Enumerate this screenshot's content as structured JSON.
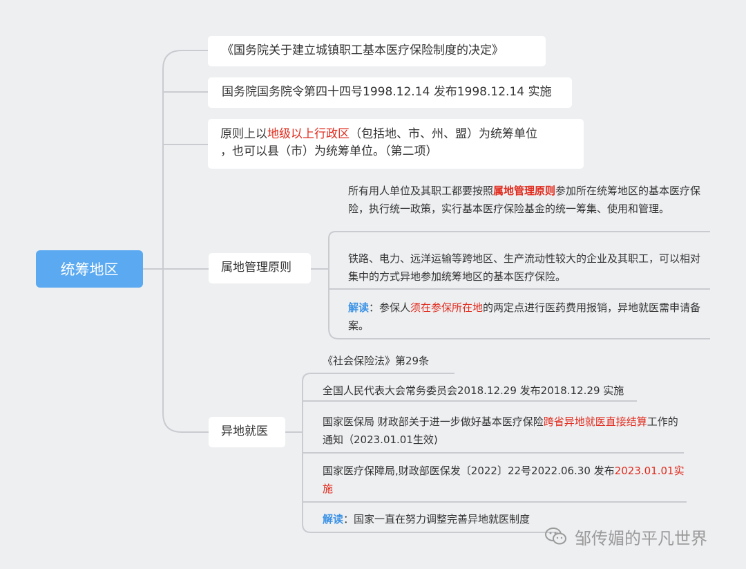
{
  "root": {
    "label": "统筹地区"
  },
  "branches": {
    "doc_title": "《国务院关于建立城镇职工基本医疗保险制度的决定》",
    "decree": "国务院国务院令第四十四号1998.12.14 发布1998.12.14 实施",
    "principle": {
      "pre": "原则上以",
      "hl": "地级以上行政区",
      "post": "（包括地、市、州、盟）为统筹单位",
      "line2": "，也可以县（市）为统筹单位。（第二项）"
    },
    "local_mgmt": {
      "label": "属地管理原则",
      "item1": {
        "pre": "所有用人单位及其职工都要按照",
        "hl": "属地管理原则",
        "post": "参加所在统筹地区的基本医疗保险，执行统一政策，实行基本医疗保险基金的统一筹集、使用和管理。"
      },
      "item2": "铁路、电力、远洋运输等跨地区、生产流动性较大的企业及其职工，可以相对集中的方式异地参加统筹地区的基本医疗保险。",
      "item3": {
        "tag": "解读",
        "pre": "：参保人",
        "hl": "须在参保所在地",
        "post": "的两定点进行医药费用报销，异地就医需申请备案。"
      }
    },
    "remote": {
      "label": "异地就医",
      "law": "《社会保险法》第29条",
      "law_pub": "全国人民代表大会常务委员会2018.12.29 发布2018.12.29 实施",
      "notice": {
        "pre": "国家医保局 财政部关于进一步做好基本医疗保险",
        "hl": "跨省异地就医直接结算",
        "post": "工作的通知（2023.01.01生效)"
      },
      "notice_pub": {
        "pre": "国家医疗保障局,财政部医保发〔2022〕22号2022.06.30 发布",
        "hl": "2023.01.01实施"
      },
      "interp": {
        "tag": "解读",
        "text": "：国家一直在努力调整完善异地就医制度"
      }
    }
  },
  "watermark": {
    "text": "邹传媚的平凡世界",
    "icon": "wechat-icon"
  },
  "colors": {
    "root": "#5aa9f1",
    "highlight": "#e02b1d",
    "tag": "#3c93e6",
    "line": "#c9cbd0",
    "background": "#eeeff1"
  }
}
